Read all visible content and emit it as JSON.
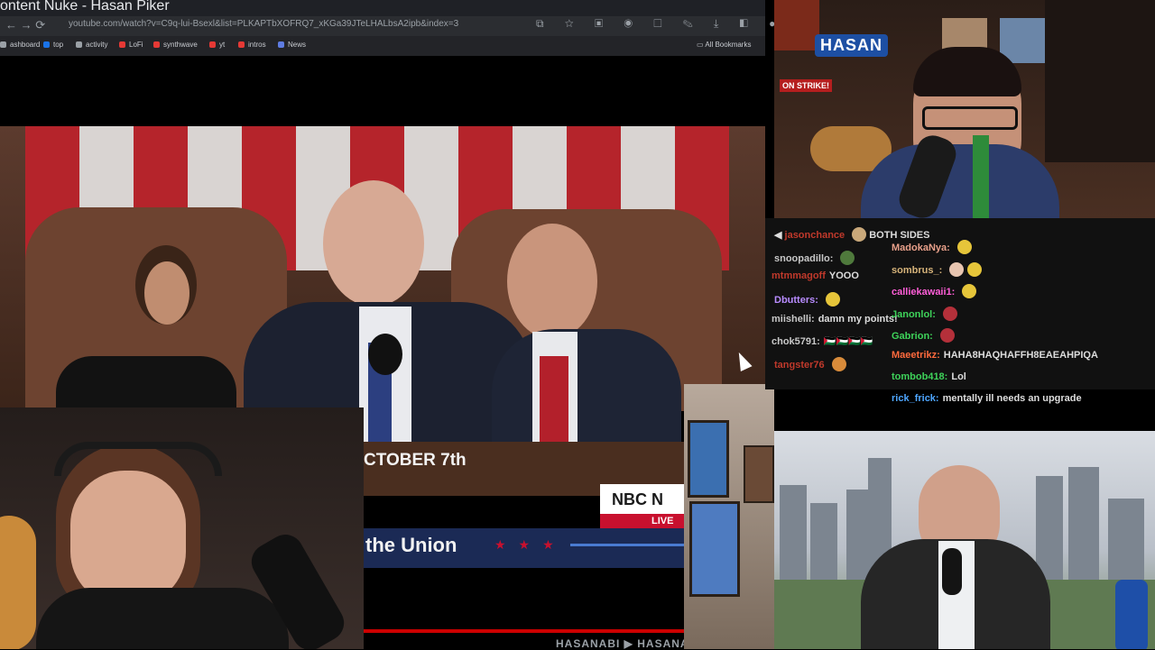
{
  "browser": {
    "tab_title": "ontent Nuke - Hasan Piker",
    "url": "youtube.com/watch?v=C9q-lui-Bsexl&list=PLKAPTbXOFRQ7_xKGa39JTeLHALbsA2ipb&index=3",
    "nav_icons": "← → ⟳",
    "bookmarks": [
      {
        "label": "ashboard",
        "color": "#9aa0a6"
      },
      {
        "label": "top",
        "color": "#1a73e8"
      },
      {
        "label": "activity",
        "color": "#9aa0a6"
      },
      {
        "label": "LoFi",
        "color": "#e53935"
      },
      {
        "label": "synthwave",
        "color": "#e53935"
      },
      {
        "label": "yt",
        "color": "#e53935"
      },
      {
        "label": "intros",
        "color": "#e53935"
      },
      {
        "label": "News",
        "color": "#5e7ce2"
      }
    ],
    "all_bookmarks": "All Bookmarks"
  },
  "news_overlay": {
    "date_text": "CTOBER 7th",
    "network": "NBC N",
    "live": "LIVE",
    "bar_text": "the Union"
  },
  "hasan_cam": {
    "logo": "HASAN",
    "sign": "ON STRIKE!"
  },
  "chat": {
    "lines": [
      {
        "user": "jasonchance",
        "color": "#c0392b",
        "text": "BOTH SIDES"
      },
      {
        "user": "snoopadillo:",
        "color": "#c8c8c8",
        "text": ""
      },
      {
        "user": "mtmmagoff",
        "color": "#c0392b",
        "text": "YOOO"
      },
      {
        "user": "Dbutters:",
        "color": "#b88cff",
        "text": ""
      },
      {
        "user": "miishelli:",
        "color": "#c8c8c8",
        "text": "damn my points!"
      },
      {
        "user": "chok5791:",
        "color": "#c8c8c8",
        "text": "🇵🇸🇵🇸🇵🇸🇵🇸"
      },
      {
        "user": "tangster76",
        "color": "#c0392b",
        "text": ""
      },
      {
        "user": "MadokaNya:",
        "color": "#e8a08a",
        "text": ""
      },
      {
        "user": "sombrus_:",
        "color": "#d6b37a",
        "text": ""
      },
      {
        "user": "calliekawaii1:",
        "color": "#ff5ed8",
        "text": ""
      },
      {
        "user": "Janonlol:",
        "color": "#3ed35a",
        "text": ""
      },
      {
        "user": "Gabrion:",
        "color": "#3ed35a",
        "text": ""
      },
      {
        "user": "Maeetrikz:",
        "color": "#ff6a3d",
        "text": "HAHA8HAQHAFFH8EAEAHPIQA"
      },
      {
        "user": "tombob418:",
        "color": "#3ed35a",
        "text": "Lol"
      },
      {
        "user": "rick_frick:",
        "color": "#4ea6ff",
        "text": "mentally ill needs an upgrade"
      }
    ]
  },
  "bottom_bar": {
    "channel": "HASANABI ▶ HASANABI"
  },
  "colors": {
    "stripe_red": "#b5242b",
    "stripe_white": "#d9d4d2",
    "nbc_red": "#c8102e",
    "lower_bar_blue": "#1b2a55"
  }
}
